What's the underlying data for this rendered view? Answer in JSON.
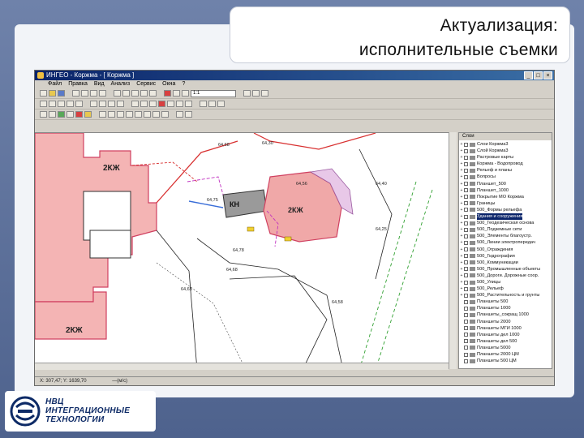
{
  "slide": {
    "title_line1": "Актуализация:",
    "title_line2": "исполнительные съемки"
  },
  "app": {
    "window_title": "ИНГЕО - Коржма - [ Коржма ]",
    "menu": [
      "Файл",
      "Правка",
      "Вид",
      "Анализ",
      "Сервис",
      "Окна",
      "?"
    ],
    "scale_value": "1:1",
    "status_coords": "X: 307,47; Y: 1639,70",
    "status_mode": "—(м/с)"
  },
  "map_labels": {
    "zone_left_top": "2КЖ",
    "zone_left_bottom": "2КЖ",
    "building_kn": "КН",
    "building_2kzh": "2КЖ",
    "elev1": "64,75",
    "elev2": "64,68",
    "elev3": "64,56",
    "elev4": "64,40",
    "elev5": "64,30",
    "elev6": "64,25",
    "elev7": "64,68",
    "elev8": "64,58",
    "elev9": "64,65",
    "elev10": "64,78"
  },
  "layers_panel": {
    "tab_label": "Слои",
    "items": [
      {
        "label": "Слои Коржма3",
        "selected": false
      },
      {
        "label": "Слой Коржма3",
        "selected": false
      },
      {
        "label": "Растровые карты",
        "selected": false
      },
      {
        "label": "Коржма - Водопровод",
        "selected": false
      },
      {
        "label": "Рельеф и планы",
        "selected": false
      },
      {
        "label": "Вопросы",
        "selected": false
      },
      {
        "label": "Планшет_500",
        "selected": false
      },
      {
        "label": "Планшет_1000",
        "selected": false
      },
      {
        "label": "Покрытие МО Коржма",
        "selected": false
      },
      {
        "label": "Границы",
        "selected": false
      },
      {
        "label": "500_Формы рельефа",
        "selected": false
      },
      {
        "label": "Здания и сооружения",
        "selected": true
      },
      {
        "label": "500_Геодезическая основа",
        "selected": false
      },
      {
        "label": "500_Подземные сети",
        "selected": false
      },
      {
        "label": "500_Элементы благоустр.",
        "selected": false
      },
      {
        "label": "500_Линии электропередач",
        "selected": false
      },
      {
        "label": "500_Ограждения",
        "selected": false
      },
      {
        "label": "500_Гидрография",
        "selected": false
      },
      {
        "label": "500_Коммуникации",
        "selected": false
      },
      {
        "label": "500_Промышленные объекты",
        "selected": false
      },
      {
        "label": "500_Дороги. Дорожные соор.",
        "selected": false
      },
      {
        "label": "500_Улицы",
        "selected": false
      },
      {
        "label": "500_Рельеф",
        "selected": false
      },
      {
        "label": "500_Растительность и грунты",
        "selected": false
      },
      {
        "label": "Планшеты 500",
        "selected": false
      },
      {
        "label": "Планшеты 1000",
        "selected": false
      },
      {
        "label": "Планшеты_сокращ 1000",
        "selected": false
      },
      {
        "label": "Планшеты 2000",
        "selected": false
      },
      {
        "label": "Планшеты МГИ 1000",
        "selected": false
      },
      {
        "label": "Планшеты дел 1000",
        "selected": false
      },
      {
        "label": "Планшеты дел 500",
        "selected": false
      },
      {
        "label": "Планшеты 5000",
        "selected": false
      },
      {
        "label": "Планшеты 2000 ЦМ",
        "selected": false
      },
      {
        "label": "Планшеты 500 ЦМ",
        "selected": false
      }
    ]
  },
  "logo": {
    "line1": "НВЦ",
    "line2": "ИНТЕГРАЦИОННЫЕ",
    "line3": "ТЕХНОЛОГИИ"
  },
  "colors": {
    "zone_fill": "#f4b4b4",
    "zone_stroke": "#d04060",
    "building_fill": "#f0a8a8",
    "kn_fill": "#9a9a9a",
    "selection_blue": "#0a246a"
  }
}
